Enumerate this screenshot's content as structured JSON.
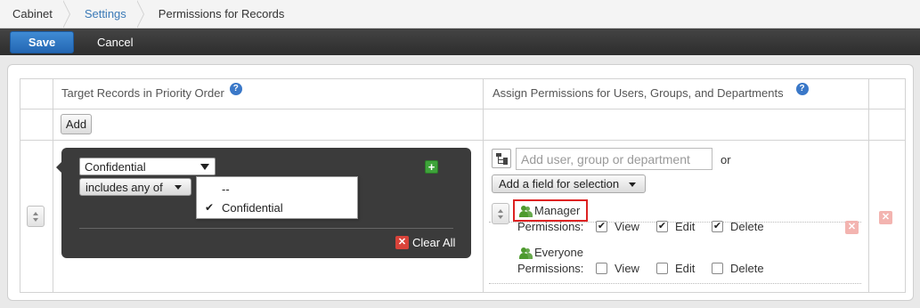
{
  "breadcrumb": {
    "items": [
      "Cabinet",
      "Settings",
      "Permissions for Records"
    ]
  },
  "toolbar": {
    "save_label": "Save",
    "cancel_label": "Cancel"
  },
  "table": {
    "header_left": "Target Records in Priority Order",
    "header_right": "Assign Permissions for Users, Groups, and Departments",
    "help_icon": "?",
    "add_label": "Add"
  },
  "condition": {
    "field_value": "Confidential",
    "operator_value": "includes any of",
    "dropdown_options": [
      "--",
      "Confidential"
    ],
    "selected_option": "Confidential",
    "add_icon": "+",
    "clear_all_label": "Clear All"
  },
  "permissions": {
    "search_placeholder": "Add user, group or department",
    "or_label": "or",
    "add_field_label": "Add a field for selection",
    "entries": [
      {
        "name": "Manager",
        "permissions_label": "Permissions:",
        "view_label": "View",
        "edit_label": "Edit",
        "delete_label": "Delete",
        "view": true,
        "edit": true,
        "delete": true
      },
      {
        "name": "Everyone",
        "permissions_label": "Permissions:",
        "view_label": "View",
        "edit_label": "Edit",
        "delete_label": "Delete",
        "view": false,
        "edit": false,
        "delete": false
      }
    ]
  },
  "colors": {
    "save_button": "#2a6fbd",
    "toolbar": "#333333",
    "condition_box": "#3b3b3b",
    "user_icon": "#4e9a2e",
    "highlight": "#dd2222"
  }
}
